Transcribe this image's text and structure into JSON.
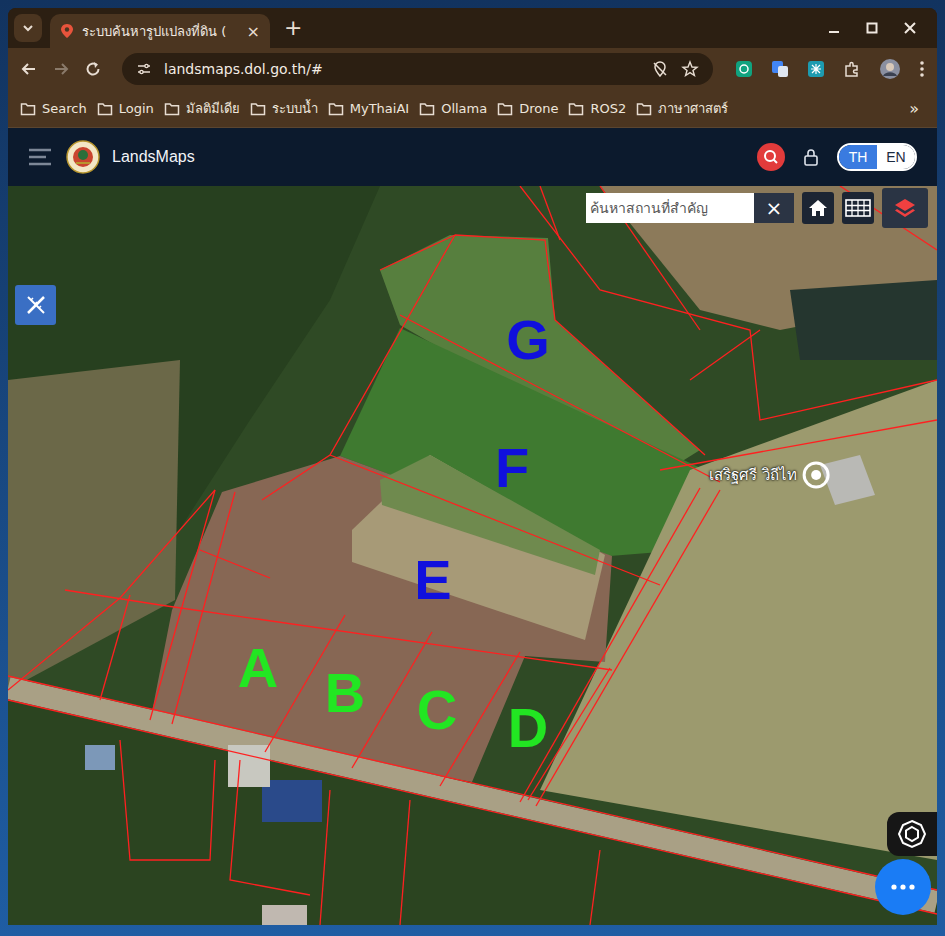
{
  "browser": {
    "tab": {
      "title": "ระบบค้นหารูปแปลงที่ดิน (",
      "selected": true,
      "close": "×"
    },
    "new_tab": "+",
    "address": "landsmaps.dol.go.th/#",
    "bookmarks": [
      "Search",
      "Login",
      "มัลติมีเดีย",
      "ระบบน้ำ",
      "MyThaiAI",
      "Ollama",
      "Drone",
      "ROS2",
      "ภาษาศาสตร์"
    ],
    "bookmarks_more": "»"
  },
  "app": {
    "brand": "LandsMaps",
    "languages": [
      {
        "label": "TH",
        "selected": true
      },
      {
        "label": "EN",
        "selected": false
      }
    ],
    "search": {
      "placeholder": "ค้นหาสถานที่สำคัญ",
      "clear": "×"
    }
  },
  "map": {
    "parcels": [
      {
        "label": "G",
        "color": "#1010dd"
      },
      {
        "label": "F",
        "color": "#1010dd"
      },
      {
        "label": "E",
        "color": "#1010dd"
      },
      {
        "label": "A",
        "color": "#22e622"
      },
      {
        "label": "B",
        "color": "#22e622"
      },
      {
        "label": "C",
        "color": "#22e622"
      },
      {
        "label": "D",
        "color": "#22e622"
      }
    ],
    "places": [
      {
        "name": "เสริฐศรี วิถีไท"
      }
    ]
  }
}
